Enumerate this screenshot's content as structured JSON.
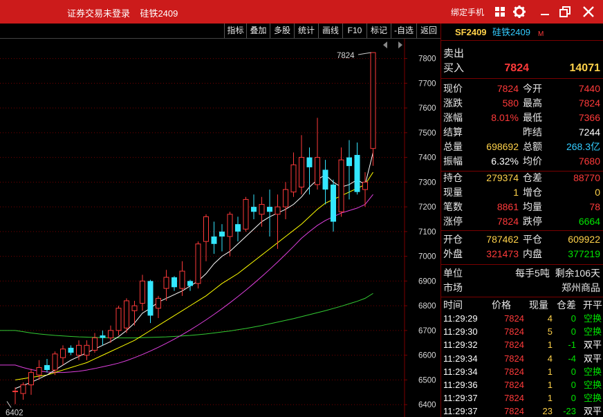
{
  "titlebar": {
    "app_title": "证券交易未登录    硅铁2409",
    "bind_phone": "绑定手机",
    "icons": [
      "grid-icon",
      "gear-icon",
      "minimize-icon",
      "restore-icon",
      "close-icon"
    ]
  },
  "toolbar": {
    "buttons": [
      "指标",
      "叠加",
      "多股",
      "统计",
      "画线",
      "F10",
      "标记",
      "-自选",
      "返回"
    ]
  },
  "chart_data": {
    "type": "candlestick",
    "ylim": [
      6350,
      7880
    ],
    "yticks": [
      6400,
      6500,
      6600,
      6700,
      6800,
      6900,
      7000,
      7100,
      7200,
      7300,
      7400,
      7500,
      7600,
      7700,
      7800
    ],
    "annotations": [
      {
        "label": "7824",
        "value": 7824
      },
      {
        "label": "6402",
        "value": 6402
      }
    ],
    "candles": [
      {
        "o": 6452,
        "h": 6470,
        "l": 6402,
        "c": 6455
      },
      {
        "o": 6445,
        "h": 6490,
        "l": 6420,
        "c": 6480
      },
      {
        "o": 6480,
        "h": 6545,
        "l": 6440,
        "c": 6530
      },
      {
        "o": 6520,
        "h": 6580,
        "l": 6500,
        "c": 6550
      },
      {
        "o": 6560,
        "h": 6585,
        "l": 6530,
        "c": 6540
      },
      {
        "o": 6540,
        "h": 6615,
        "l": 6520,
        "c": 6605
      },
      {
        "o": 6590,
        "h": 6640,
        "l": 6560,
        "c": 6625
      },
      {
        "o": 6630,
        "h": 6640,
        "l": 6600,
        "c": 6610
      },
      {
        "o": 6600,
        "h": 6660,
        "l": 6580,
        "c": 6640
      },
      {
        "o": 6600,
        "h": 6660,
        "l": 6580,
        "c": 6640
      },
      {
        "o": 6620,
        "h": 6690,
        "l": 6610,
        "c": 6670
      },
      {
        "o": 6680,
        "h": 6700,
        "l": 6640,
        "c": 6670
      },
      {
        "o": 6670,
        "h": 6720,
        "l": 6650,
        "c": 6700
      },
      {
        "o": 6700,
        "h": 6800,
        "l": 6680,
        "c": 6790
      },
      {
        "o": 6710,
        "h": 6830,
        "l": 6690,
        "c": 6820
      },
      {
        "o": 6780,
        "h": 6820,
        "l": 6720,
        "c": 6800
      },
      {
        "o": 6810,
        "h": 6925,
        "l": 6780,
        "c": 6900
      },
      {
        "o": 6900,
        "h": 6905,
        "l": 6730,
        "c": 6760
      },
      {
        "o": 6790,
        "h": 6840,
        "l": 6750,
        "c": 6830
      },
      {
        "o": 6870,
        "h": 6945,
        "l": 6820,
        "c": 6915
      },
      {
        "o": 6915,
        "h": 6920,
        "l": 6860,
        "c": 6875
      },
      {
        "o": 6870,
        "h": 6980,
        "l": 6840,
        "c": 6940
      },
      {
        "o": 6900,
        "h": 6905,
        "l": 6860,
        "c": 6880
      },
      {
        "o": 6890,
        "h": 7060,
        "l": 6870,
        "c": 7050
      },
      {
        "o": 7060,
        "h": 7170,
        "l": 6980,
        "c": 7160
      },
      {
        "o": 7080,
        "h": 7140,
        "l": 7010,
        "c": 7050
      },
      {
        "o": 7100,
        "h": 7130,
        "l": 7020,
        "c": 7080
      },
      {
        "o": 7080,
        "h": 7180,
        "l": 7000,
        "c": 7170
      },
      {
        "o": 7130,
        "h": 7160,
        "l": 7060,
        "c": 7100
      },
      {
        "o": 7110,
        "h": 7240,
        "l": 7100,
        "c": 7230
      },
      {
        "o": 7200,
        "h": 7250,
        "l": 7150,
        "c": 7180
      },
      {
        "o": 7170,
        "h": 7240,
        "l": 7120,
        "c": 7210
      },
      {
        "o": 7200,
        "h": 7270,
        "l": 7080,
        "c": 7180
      },
      {
        "o": 7170,
        "h": 7250,
        "l": 7030,
        "c": 7200
      },
      {
        "o": 7200,
        "h": 7300,
        "l": 7150,
        "c": 7270
      },
      {
        "o": 7260,
        "h": 7420,
        "l": 7240,
        "c": 7370
      },
      {
        "o": 7280,
        "h": 7490,
        "l": 7250,
        "c": 7400
      },
      {
        "o": 7400,
        "h": 7440,
        "l": 7250,
        "c": 7360
      },
      {
        "o": 7290,
        "h": 7560,
        "l": 7270,
        "c": 7400
      },
      {
        "o": 7350,
        "h": 7390,
        "l": 7210,
        "c": 7270
      },
      {
        "o": 7290,
        "h": 7310,
        "l": 7100,
        "c": 7140
      },
      {
        "o": 7180,
        "h": 7440,
        "l": 7160,
        "c": 7390
      },
      {
        "o": 7400,
        "h": 7470,
        "l": 7230,
        "c": 7365
      },
      {
        "o": 7410,
        "h": 7460,
        "l": 7250,
        "c": 7260
      },
      {
        "o": 7270,
        "h": 7340,
        "l": 7200,
        "c": 7300
      },
      {
        "o": 7436,
        "h": 7824,
        "l": 7366,
        "c": 7824
      }
    ],
    "ma5": [
      6465,
      6478,
      6490,
      6505,
      6520,
      6540,
      6560,
      6580,
      6595,
      6610,
      6625,
      6640,
      6655,
      6675,
      6700,
      6730,
      6770,
      6790,
      6815,
      6830,
      6845,
      6860,
      6880,
      6900,
      6930,
      6970,
      7000,
      7020,
      7050,
      7080,
      7110,
      7140,
      7160,
      7175,
      7190,
      7210,
      7240,
      7280,
      7310,
      7330,
      7300,
      7280,
      7290,
      7310,
      7290,
      7420
    ],
    "ma10": [
      6500,
      6505,
      6510,
      6515,
      6520,
      6530,
      6540,
      6550,
      6560,
      6570,
      6585,
      6600,
      6615,
      6630,
      6645,
      6660,
      6680,
      6700,
      6720,
      6740,
      6760,
      6780,
      6800,
      6820,
      6840,
      6865,
      6890,
      6910,
      6930,
      6955,
      6980,
      7005,
      7030,
      7055,
      7080,
      7105,
      7130,
      7160,
      7190,
      7215,
      7230,
      7245,
      7260,
      7275,
      7290,
      7340
    ],
    "ma20": [
      6560,
      6550,
      6542,
      6536,
      6532,
      6530,
      6530,
      6532,
      6535,
      6540,
      6546,
      6553,
      6560,
      6568,
      6578,
      6590,
      6603,
      6617,
      6632,
      6648,
      6665,
      6683,
      6702,
      6722,
      6743,
      6765,
      6788,
      6812,
      6837,
      6863,
      6890,
      6918,
      6947,
      6977,
      7008,
      7040,
      7073,
      7100,
      7125,
      7145,
      7160,
      7175,
      7185,
      7195,
      7210,
      7250
    ],
    "ma60": [
      6700,
      6695,
      6690,
      6686,
      6683,
      6680,
      6678,
      6676,
      6674,
      6673,
      6672,
      6671,
      6670,
      6670,
      6670,
      6670,
      6671,
      6672,
      6673,
      6674,
      6676,
      6678,
      6680,
      6683,
      6686,
      6690,
      6694,
      6698,
      6703,
      6708,
      6714,
      6720,
      6727,
      6734,
      6741,
      6748,
      6756,
      6764,
      6772,
      6780,
      6789,
      6798,
      6808,
      6818,
      6830,
      6850
    ]
  },
  "panel": {
    "header": {
      "code": "SF2409",
      "name": "硅铁2409",
      "badge": "M"
    },
    "sell_label": "卖出",
    "buy_label": "买入",
    "buy_price": "7824",
    "buy_volume": "14071",
    "quote_rows": [
      [
        {
          "l": "现价",
          "v": "7824",
          "c": "red"
        },
        {
          "l": "今开",
          "v": "7440",
          "c": "red"
        }
      ],
      [
        {
          "l": "涨跌",
          "v": "580",
          "c": "red"
        },
        {
          "l": "最高",
          "v": "7824",
          "c": "red"
        }
      ],
      [
        {
          "l": "涨幅",
          "v": "8.01%",
          "c": "red"
        },
        {
          "l": "最低",
          "v": "7366",
          "c": "red"
        }
      ],
      [
        {
          "l": "结算",
          "v": "",
          "c": "red"
        },
        {
          "l": "昨结",
          "v": "7244",
          "c": "white"
        }
      ],
      [
        {
          "l": "总量",
          "v": "698692",
          "c": "yellow"
        },
        {
          "l": "总额",
          "v": "268.3亿",
          "c": "cyan"
        }
      ],
      [
        {
          "l": "振幅",
          "v": "6.32%",
          "c": "white"
        },
        {
          "l": "均价",
          "v": "7680",
          "c": "red"
        }
      ]
    ],
    "pos_rows": [
      [
        {
          "l": "持仓",
          "v": "279374",
          "c": "yellow"
        },
        {
          "l": "仓差",
          "v": "88770",
          "c": "red"
        }
      ],
      [
        {
          "l": "现量",
          "v": "1",
          "c": "yellow"
        },
        {
          "l": "增仓",
          "v": "0",
          "c": "yellow"
        }
      ],
      [
        {
          "l": "笔数",
          "v": "8861",
          "c": "red"
        },
        {
          "l": "均量",
          "v": "78",
          "c": "red"
        }
      ],
      [
        {
          "l": "涨停",
          "v": "7824",
          "c": "red"
        },
        {
          "l": "跌停",
          "v": "6664",
          "c": "green"
        }
      ]
    ],
    "open_rows": [
      [
        {
          "l": "开仓",
          "v": "787462",
          "c": "yellow"
        },
        {
          "l": "平仓",
          "v": "609922",
          "c": "yellow"
        }
      ],
      [
        {
          "l": "外盘",
          "v": "321473",
          "c": "red"
        },
        {
          "l": "内盘",
          "v": "377219",
          "c": "green"
        }
      ]
    ],
    "unit_label": "单位",
    "unit_value": "每手5吨  剩余106天",
    "market_label": "市场",
    "market_value": "郑州商品",
    "tick_header": [
      "时间",
      "价格",
      "现量",
      "仓差",
      "开平"
    ],
    "ticks": [
      {
        "t": "11:29:29",
        "p": "7824",
        "v": "4",
        "d": "0",
        "k": "空换",
        "dc": "green",
        "kc": "green"
      },
      {
        "t": "11:29:30",
        "p": "7824",
        "v": "5",
        "d": "0",
        "k": "空换",
        "dc": "green",
        "kc": "green"
      },
      {
        "t": "11:29:32",
        "p": "7824",
        "v": "1",
        "d": "-1",
        "k": "双平",
        "dc": "green",
        "kc": "white"
      },
      {
        "t": "11:29:34",
        "p": "7824",
        "v": "4",
        "d": "-4",
        "k": "双平",
        "dc": "green",
        "kc": "white"
      },
      {
        "t": "11:29:34",
        "p": "7824",
        "v": "1",
        "d": "0",
        "k": "空换",
        "dc": "green",
        "kc": "green"
      },
      {
        "t": "11:29:36",
        "p": "7824",
        "v": "1",
        "d": "0",
        "k": "空换",
        "dc": "green",
        "kc": "green"
      },
      {
        "t": "11:29:37",
        "p": "7824",
        "v": "1",
        "d": "0",
        "k": "空换",
        "dc": "green",
        "kc": "green"
      },
      {
        "t": "11:29:37",
        "p": "7824",
        "v": "23",
        "d": "-23",
        "k": "双平",
        "dc": "green",
        "kc": "white"
      }
    ]
  },
  "colors": {
    "up": "#ff3a3a",
    "down": "#33e6ff",
    "ma5": "#ffffff",
    "ma10": "#ffff00",
    "ma20": "#e040e0",
    "ma60": "#33cc33"
  }
}
